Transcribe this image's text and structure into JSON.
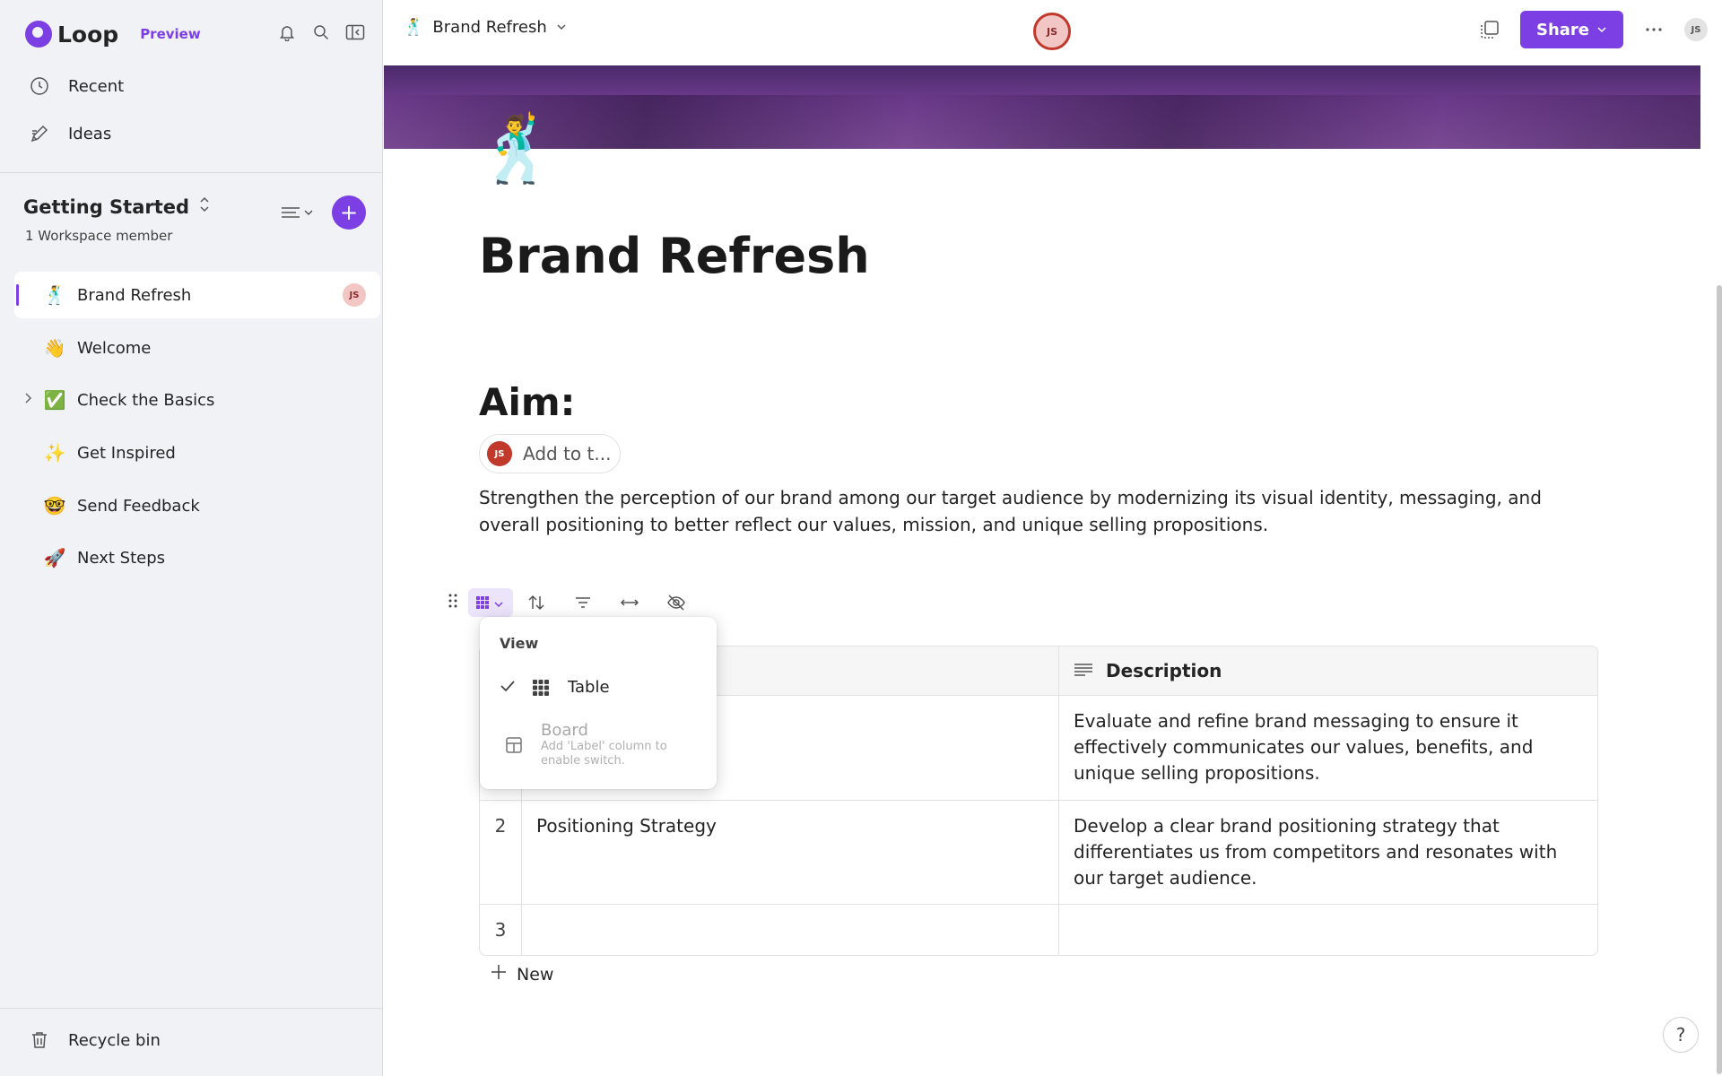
{
  "app": {
    "name": "Loop",
    "badge": "Preview"
  },
  "nav": {
    "recent": "Recent",
    "ideas": "Ideas"
  },
  "workspace": {
    "title": "Getting Started",
    "members": "1 Workspace member"
  },
  "pages": [
    {
      "emoji": "🕺",
      "label": "Brand Refresh",
      "avatar": "JS",
      "active": true
    },
    {
      "emoji": "👋",
      "label": "Welcome"
    },
    {
      "emoji": "✅",
      "label": "Check the Basics",
      "expandable": true
    },
    {
      "emoji": "✨",
      "label": "Get Inspired"
    },
    {
      "emoji": "🤓",
      "label": "Send Feedback"
    },
    {
      "emoji": "🚀",
      "label": "Next Steps"
    }
  ],
  "recycle_bin": "Recycle bin",
  "topbar": {
    "doc_emoji": "🕺",
    "doc_title": "Brand Refresh",
    "presence_initials": "JS",
    "share_label": "Share",
    "user_initials": "JS"
  },
  "document": {
    "emoji": "🕺",
    "title": "Brand Refresh",
    "heading": "Aim:",
    "assign_avatar": "JS",
    "assign_label": "Add to t...",
    "paragraph": "Strengthen the perception of our brand among our target audience by modernizing its visual identity, messaging, and overall positioning to better reflect our values, mission, and unique selling propositions."
  },
  "table": {
    "description_header": "Description",
    "rows": [
      {
        "num": "1",
        "name": "",
        "description": "Evaluate and refine brand messaging to ensure it effectively communicates our values, benefits, and unique selling propositions."
      },
      {
        "num": "2",
        "name": "Positioning Strategy",
        "description": "Develop a clear brand positioning strategy that differentiates us from competitors and resonates with our target audience."
      },
      {
        "num": "3",
        "name": "",
        "description": ""
      }
    ],
    "new_label": "New"
  },
  "view_menu": {
    "title": "View",
    "table_label": "Table",
    "board_label": "Board",
    "board_hint": "Add 'Label' column to enable switch."
  },
  "help_label": "?",
  "colors": {
    "accent": "#7b3fe4",
    "sidebar_bg": "#f0f2f6"
  }
}
